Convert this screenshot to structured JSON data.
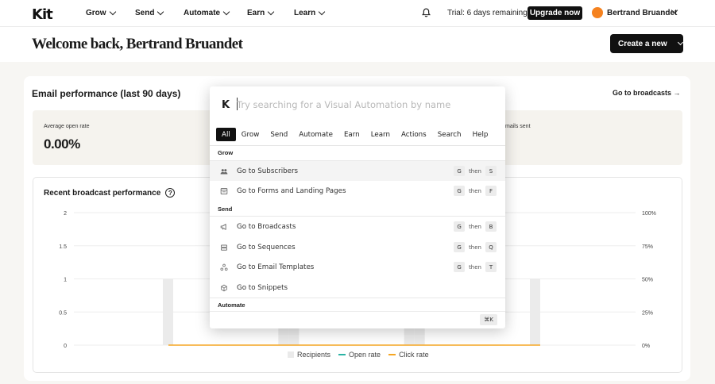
{
  "nav": {
    "logo": "Kit",
    "items": [
      {
        "label": "Grow"
      },
      {
        "label": "Send"
      },
      {
        "label": "Automate"
      },
      {
        "label": "Earn"
      },
      {
        "label": "Learn"
      }
    ],
    "trial_text": "Trial: 6 days remaining",
    "upgrade_label": "Upgrade now",
    "user_name": "Bertrand Bruandet",
    "avatar_color": "#f5821f"
  },
  "header": {
    "welcome": "Welcome back, Bertrand Bruandet",
    "create_label": "Create a new"
  },
  "performance": {
    "title": "Email performance (last 90 days)",
    "go_broadcasts": "Go to broadcasts →",
    "open_rate_label": "Average open rate",
    "open_rate_value": "0.00%",
    "emails_sent_label": "mails sent"
  },
  "chart": {
    "title": "Recent broadcast performance",
    "help": "?",
    "legend": {
      "recipients": "Recipients",
      "open_rate": "Open rate",
      "click_rate": "Click rate"
    }
  },
  "chart_data": {
    "type": "bar",
    "title": "Recent broadcast performance",
    "y_left_ticks": [
      "0",
      "0.5",
      "1",
      "1.5",
      "2"
    ],
    "y_right_ticks": [
      "0%",
      "25%",
      "50%",
      "75%",
      "100%"
    ],
    "ylim_left": [
      0,
      2
    ],
    "ylim_right": [
      0,
      100
    ],
    "series": [
      {
        "name": "Recipients",
        "values": [
          1,
          1,
          1
        ],
        "color": "#ebebeb"
      },
      {
        "name": "Open rate",
        "values": [
          0,
          0,
          0
        ],
        "color": "#2bb3a4"
      },
      {
        "name": "Click rate",
        "values": [
          0,
          0,
          0
        ],
        "color": "#f5a623"
      }
    ]
  },
  "palette": {
    "logo": "K",
    "placeholder": "Try searching for a Visual Automation by name",
    "tabs": [
      "All",
      "Grow",
      "Send",
      "Automate",
      "Earn",
      "Learn",
      "Actions",
      "Search",
      "Help"
    ],
    "sections": {
      "grow": "Grow",
      "send": "Send",
      "automate": "Automate"
    },
    "then": "then",
    "items": [
      {
        "label": "Go to Subscribers",
        "icon": "users-icon",
        "keys": [
          "G",
          "S"
        ]
      },
      {
        "label": "Go to Forms and Landing Pages",
        "icon": "form-icon",
        "keys": [
          "G",
          "F"
        ]
      },
      {
        "label": "Go to Broadcasts",
        "icon": "megaphone-icon",
        "keys": [
          "G",
          "B"
        ]
      },
      {
        "label": "Go to Sequences",
        "icon": "sequence-icon",
        "keys": [
          "G",
          "Q"
        ]
      },
      {
        "label": "Go to Email Templates",
        "icon": "template-icon",
        "keys": [
          "G",
          "T"
        ]
      },
      {
        "label": "Go to Snippets",
        "icon": "snippet-icon",
        "keys": []
      }
    ],
    "shortcut": "⌘K"
  }
}
